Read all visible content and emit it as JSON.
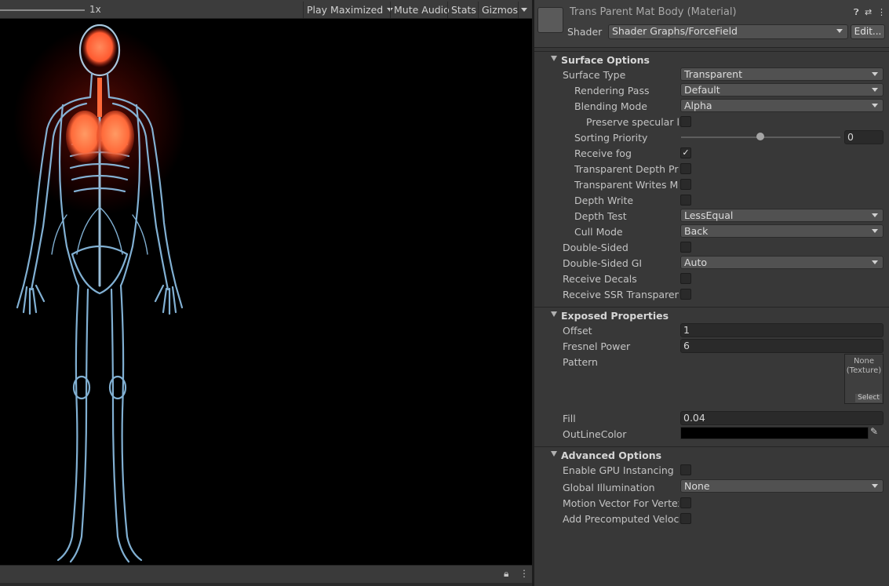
{
  "game_toolbar": {
    "scale": "1x",
    "play_maximized": "Play Maximized",
    "mute_audio": "Mute Audio",
    "stats": "Stats",
    "gizmos": "Gizmos"
  },
  "inspector": {
    "material_title": "Trans Parent Mat Body (Material)",
    "shader_label": "Shader",
    "shader_value": "Shader Graphs/ForceField",
    "edit_label": "Edit...",
    "surface": {
      "title": "Surface Options",
      "surface_type_label": "Surface Type",
      "surface_type_value": "Transparent",
      "rendering_pass_label": "Rendering Pass",
      "rendering_pass_value": "Default",
      "blending_mode_label": "Blending Mode",
      "blending_mode_value": "Alpha",
      "preserve_specular_label": "Preserve specular lig",
      "sorting_priority_label": "Sorting Priority",
      "sorting_priority_value": "0",
      "receive_fog_label": "Receive fog",
      "receive_fog_check": "✓",
      "transparent_depth_prepass_label": "Transparent Depth Prep",
      "transparent_writes_motion_label": "Transparent Writes Moti",
      "depth_write_label": "Depth Write",
      "depth_test_label": "Depth Test",
      "depth_test_value": "LessEqual",
      "cull_mode_label": "Cull Mode",
      "cull_mode_value": "Back",
      "double_sided_label": "Double-Sided",
      "double_sided_gi_label": "Double-Sided GI",
      "double_sided_gi_value": "Auto",
      "receive_decals_label": "Receive Decals",
      "receive_ssr_label": "Receive SSR Transparent"
    },
    "exposed": {
      "title": "Exposed Properties",
      "offset_label": "Offset",
      "offset_value": "1",
      "fresnel_label": "Fresnel Power",
      "fresnel_value": "6",
      "pattern_label": "Pattern",
      "texture_none": "None",
      "texture_type": "(Texture)",
      "texture_select": "Select",
      "fill_label": "Fill",
      "fill_value": "0.04",
      "outline_label": "OutLineColor"
    },
    "advanced": {
      "title": "Advanced Options",
      "gpu_instancing_label": "Enable GPU Instancing",
      "global_illumination_label": "Global Illumination",
      "global_illumination_value": "None",
      "motion_vector_label": "Motion Vector For Vertex A",
      "precomputed_velocity_label": "Add Precomputed Velocity"
    }
  }
}
